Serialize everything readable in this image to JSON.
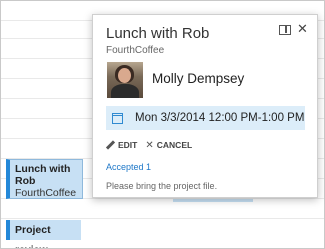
{
  "calendar": {
    "events": [
      {
        "title": "Lunch with Rob",
        "subtitle": "FourthCoffee"
      },
      {
        "title": "Project review"
      }
    ]
  },
  "popup": {
    "title": "Lunch with Rob",
    "organization": "FourthCoffee",
    "attendee": "Molly Dempsey",
    "datetime": "Mon 3/3/2014 12:00 PM-1:00 PM",
    "edit_label": "EDIT",
    "cancel_label": "CANCEL",
    "status": "Accepted 1",
    "note": "Please bring the project file.",
    "icons": {
      "expand": "expand-icon",
      "close": "close-icon",
      "calendar": "calendar-icon",
      "edit": "pencil-icon",
      "cancel": "x-icon"
    }
  },
  "colors": {
    "accent": "#2488d8",
    "event_fill": "#c7e0f4",
    "date_box": "#dcedf9",
    "link": "#1f78c8"
  }
}
